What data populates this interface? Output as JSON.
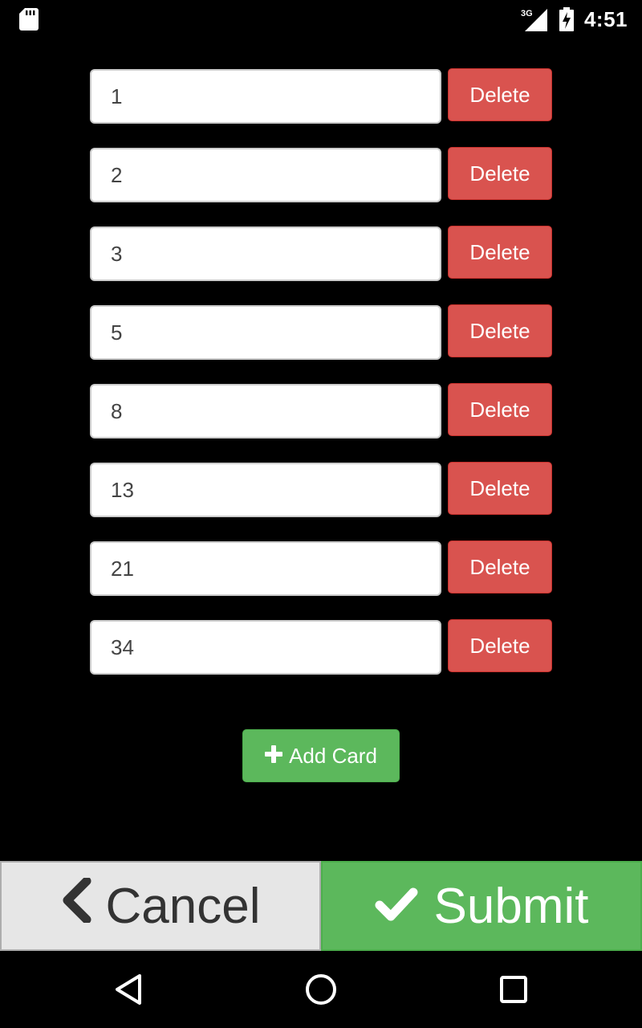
{
  "status_bar": {
    "time": "4:51",
    "network": "3G",
    "icons": [
      "sd-card-icon",
      "signal-icon",
      "battery-charging-icon"
    ]
  },
  "cards": [
    {
      "value": "1",
      "delete_label": "Delete"
    },
    {
      "value": "2",
      "delete_label": "Delete"
    },
    {
      "value": "3",
      "delete_label": "Delete"
    },
    {
      "value": "5",
      "delete_label": "Delete"
    },
    {
      "value": "8",
      "delete_label": "Delete"
    },
    {
      "value": "13",
      "delete_label": "Delete"
    },
    {
      "value": "21",
      "delete_label": "Delete"
    },
    {
      "value": "34",
      "delete_label": "Delete"
    }
  ],
  "add_card": {
    "label": "Add Card",
    "icon": "plus-icon"
  },
  "actions": {
    "cancel_label": "Cancel",
    "cancel_icon": "chevron-left-icon",
    "submit_label": "Submit",
    "submit_icon": "checkmark-icon"
  },
  "nav_bar": {
    "icons": [
      "back-triangle-icon",
      "home-circle-icon",
      "recents-square-icon"
    ]
  },
  "colors": {
    "danger": "#d9534f",
    "success": "#5cb85c",
    "cancel_bg": "#e6e6e6",
    "background": "#000000"
  }
}
